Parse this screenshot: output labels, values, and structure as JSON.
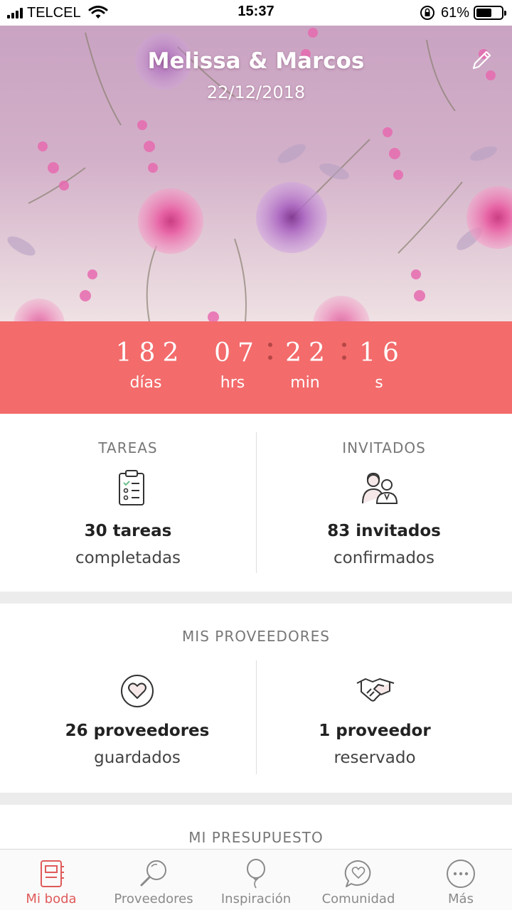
{
  "status_bar": {
    "carrier": "TELCEL",
    "time": "15:37",
    "battery_pct": "61%",
    "battery_level": 0.61,
    "icons": [
      "signal-icon",
      "wifi-icon",
      "rotation-lock-icon",
      "battery-icon"
    ]
  },
  "hero": {
    "couple_name": "Melissa & Marcos",
    "date": "22/12/2018",
    "edit_icon": "pencil-icon"
  },
  "countdown": {
    "days": "182",
    "hours": "07",
    "minutes": "22",
    "seconds": "16",
    "days_label": "días",
    "hours_label": "hrs",
    "minutes_label": "min",
    "seconds_label": "s"
  },
  "tasks": {
    "title": "TAREAS",
    "count_text": "30 tareas",
    "sub_text": "completadas",
    "icon": "clipboard-checklist-icon"
  },
  "guests": {
    "title": "INVITADOS",
    "count_text": "83 invitados",
    "sub_text": "confirmados",
    "icon": "couple-guests-icon"
  },
  "vendors": {
    "title": "MIS PROVEEDORES",
    "saved_text": "26 proveedores",
    "saved_sub": "guardados",
    "saved_icon": "heart-circle-icon",
    "booked_text": "1 proveedor",
    "booked_sub": "reservado",
    "booked_icon": "handshake-icon"
  },
  "budget": {
    "title": "MI PRESUPUESTO"
  },
  "tabbar": {
    "tabs": [
      {
        "label": "Mi boda",
        "icon": "notebook-icon",
        "active": true
      },
      {
        "label": "Proveedores",
        "icon": "magnifier-icon",
        "active": false
      },
      {
        "label": "Inspiración",
        "icon": "balloon-icon",
        "active": false
      },
      {
        "label": "Comunidad",
        "icon": "chat-heart-icon",
        "active": false
      },
      {
        "label": "Más",
        "icon": "more-dots-icon",
        "active": false
      }
    ]
  },
  "colors": {
    "accent": "#f36b6b",
    "active_tab": "#e05a5a",
    "inactive_tab": "#8a8a8a"
  }
}
